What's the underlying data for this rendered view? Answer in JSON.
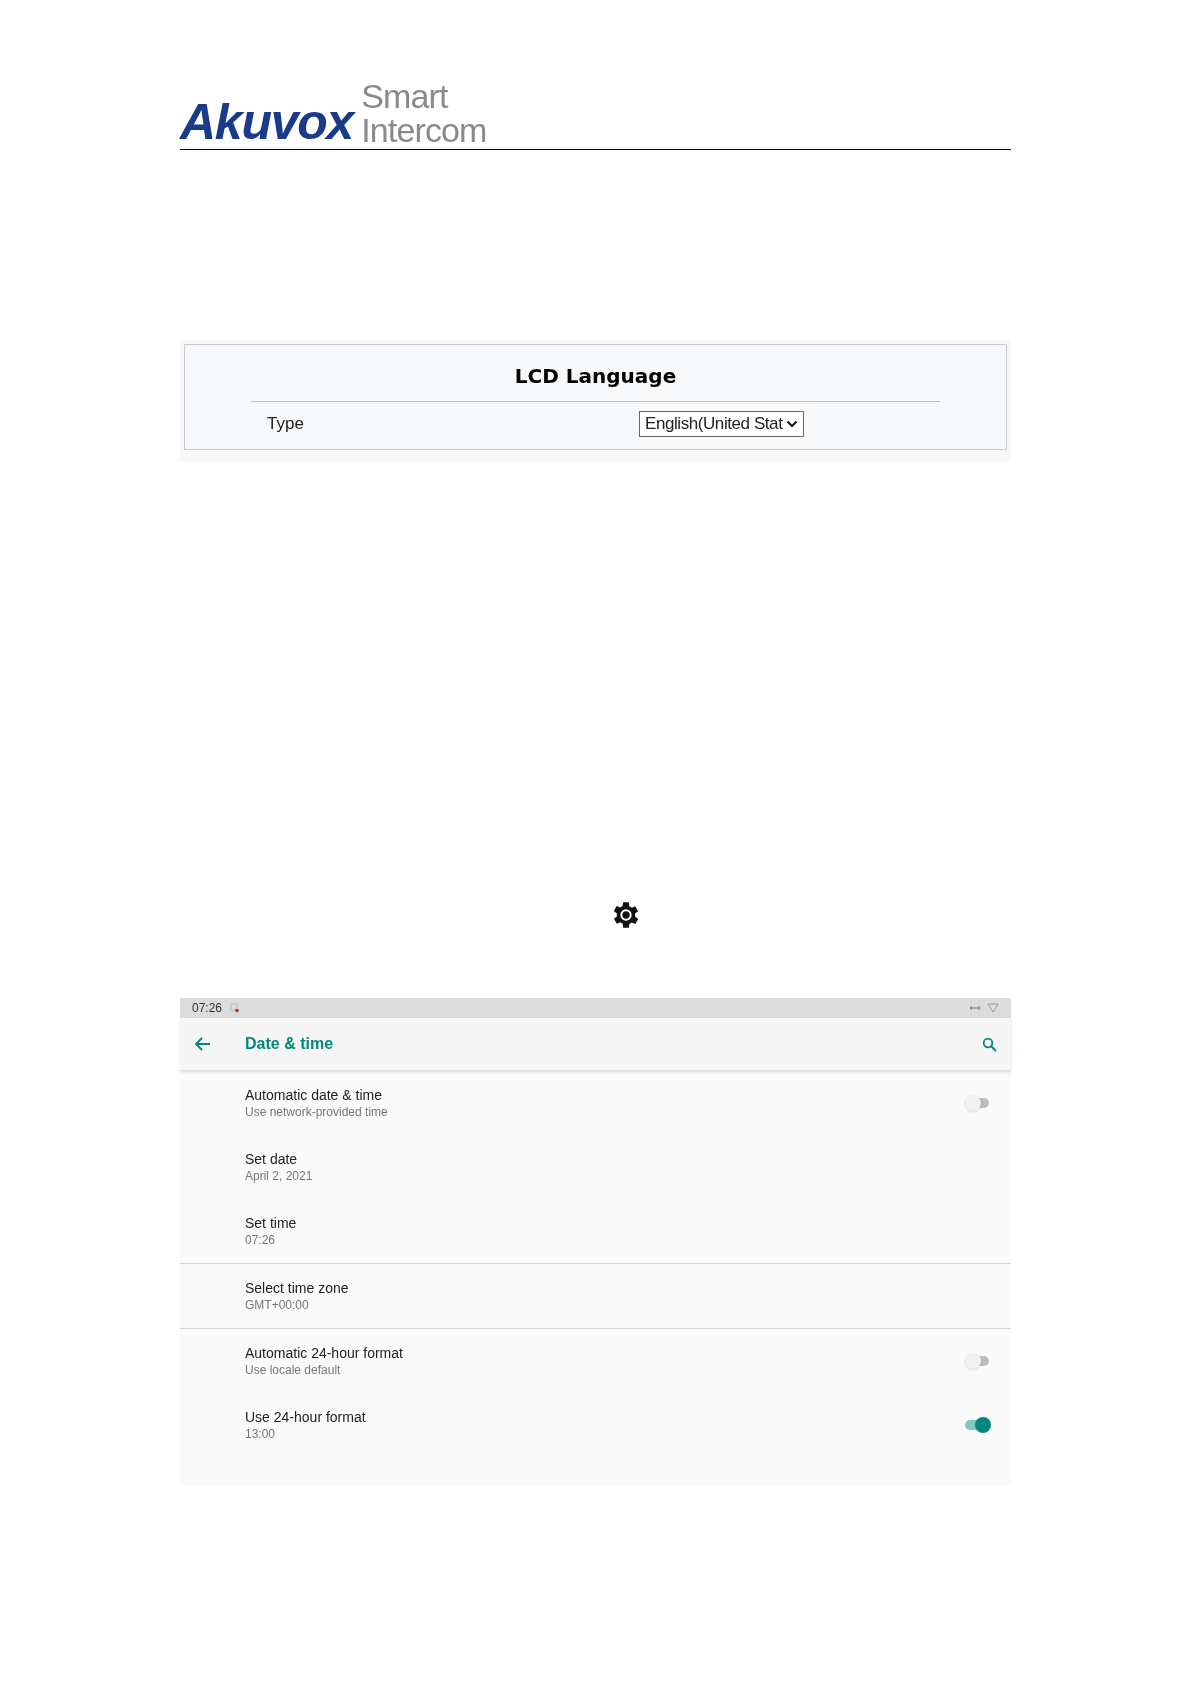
{
  "header": {
    "brand": "Akuvox",
    "tagline_top": "Smart",
    "tagline_bottom": "Intercom"
  },
  "lcd_language": {
    "title": "LCD Language",
    "rows": [
      {
        "label": "Type",
        "value": "English(United Stat"
      }
    ]
  },
  "settings_screen": {
    "status_bar": {
      "time": "07:26"
    },
    "toolbar": {
      "title": "Date & time"
    },
    "sections": [
      {
        "items": [
          {
            "kind": "switch",
            "title": "Automatic date & time",
            "summary": "Use network-provided time",
            "on": false
          },
          {
            "kind": "plain",
            "title": "Set date",
            "summary": "April 2, 2021"
          },
          {
            "kind": "plain",
            "title": "Set time",
            "summary": "07:26"
          }
        ]
      },
      {
        "items": [
          {
            "kind": "plain",
            "title": "Select time zone",
            "summary": "GMT+00:00"
          }
        ]
      },
      {
        "items": [
          {
            "kind": "switch",
            "title": "Automatic 24-hour format",
            "summary": "Use locale default",
            "on": false
          },
          {
            "kind": "switch",
            "title": "Use 24-hour format",
            "summary": "13:00",
            "on": true
          }
        ]
      }
    ]
  }
}
